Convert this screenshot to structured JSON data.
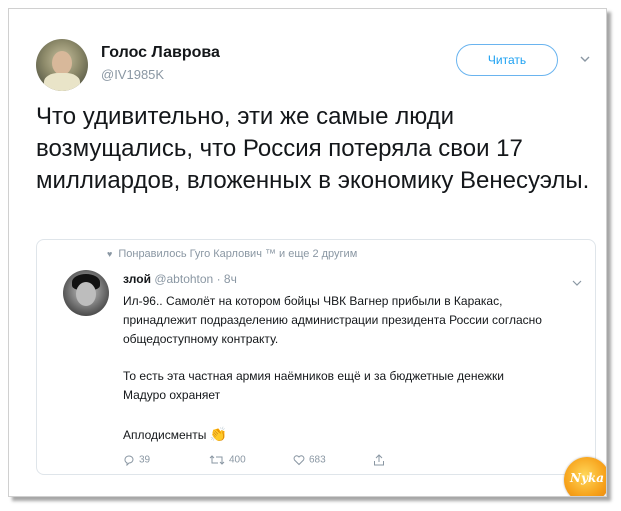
{
  "author": {
    "display_name": "Голос Лаврова",
    "handle": "@IV1985K"
  },
  "follow_button": "Читать",
  "tweet_text": "Что удивительно, эти же самые люди возмущались, что Россия потеряла свои 17 миллиардов, вложенных в экономику Венесуэлы.",
  "quoted": {
    "liked_by": "Понравилось Гуго Карлович ™ и еще 2 другим",
    "name": "злой",
    "handle": "@abtohton",
    "time": "· 8ч",
    "paragraph1": "Ил-96.. Самолёт на котором бойцы ЧВК Вагнер прибыли в Каракас, принадлежит подразделению администрации президента России согласно общедоступному контракту.",
    "paragraph2": "То есть эта частная армия наёмников ещё и за бюджетные денежки Мадуро охраняет",
    "applause_text": "Аплодисменты",
    "actions": {
      "replies": "39",
      "retweets": "400",
      "likes": "683"
    }
  },
  "watermark": "Nyka",
  "colors": {
    "accent": "#1da1f2",
    "muted": "#8a97a3",
    "text": "#14171a"
  }
}
